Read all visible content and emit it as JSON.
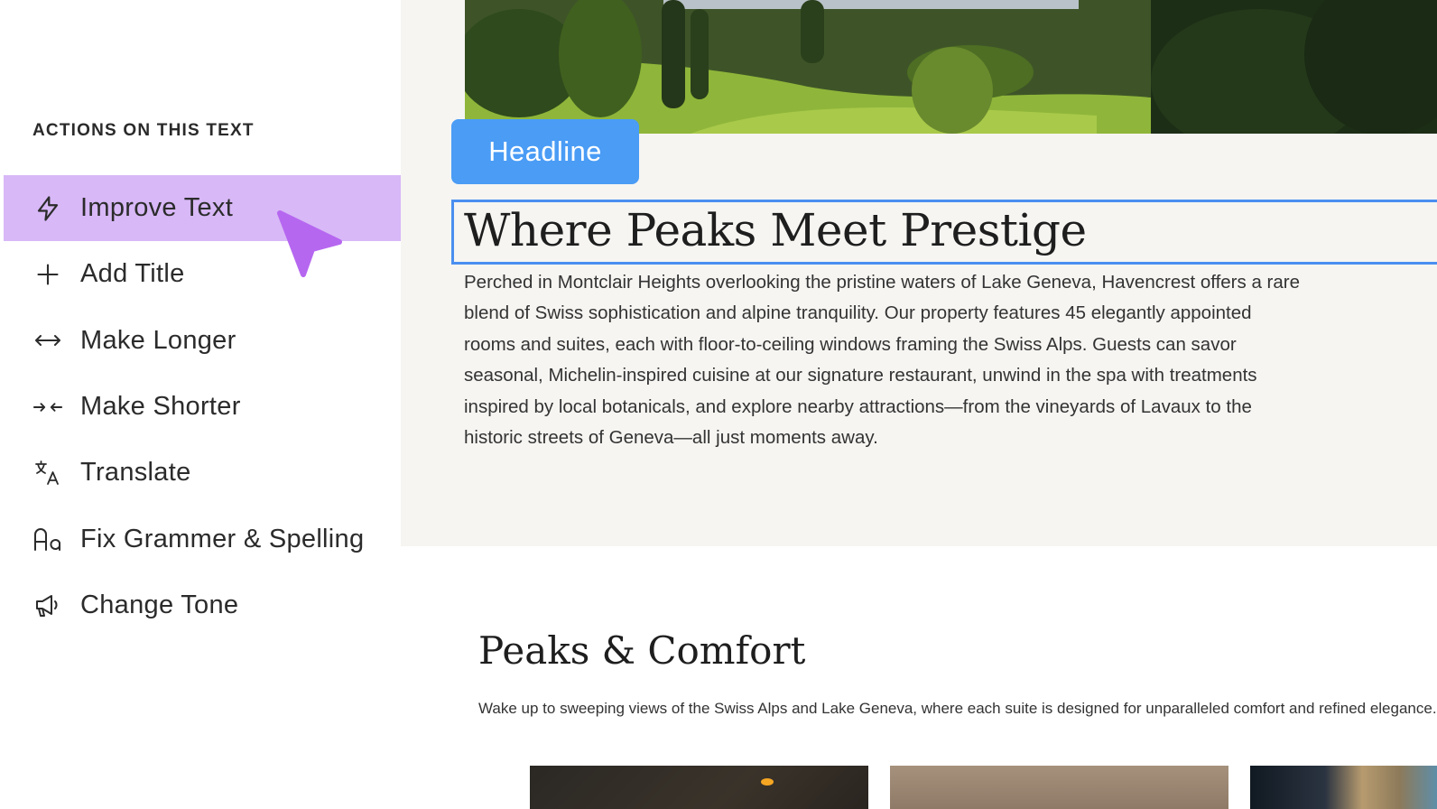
{
  "panel": {
    "title": "ACTIONS ON THIS TEXT",
    "items": [
      {
        "label": "Improve Text",
        "icon": "lightning-icon",
        "active": true
      },
      {
        "label": "Add Title",
        "icon": "plus-icon"
      },
      {
        "label": "Make Longer",
        "icon": "expand-arrows-icon"
      },
      {
        "label": "Make Shorter",
        "icon": "shrink-arrows-icon"
      },
      {
        "label": "Translate",
        "icon": "translate-icon"
      },
      {
        "label": "Fix Grammer & Spelling",
        "icon": "font-case-icon"
      },
      {
        "label": "Change Tone",
        "icon": "megaphone-icon"
      }
    ],
    "active_color": "#d8b8f7"
  },
  "editor": {
    "tag_label": "Headline",
    "tag_color": "#4a9cf5",
    "headline": "Where Peaks Meet Prestige",
    "body": "Perched in Montclair Heights overlooking the pristine waters of Lake Geneva, Havencrest offers a rare blend of Swiss sophistication and alpine tranquility. Our property features 45 elegantly appointed rooms and suites, each with floor-to-ceiling windows framing the Swiss Alps. Guests can savor seasonal, Michelin-inspired cuisine at our signature restaurant, unwind in the spa with treatments inspired by local botanicals, and explore nearby attractions—from the vineyards of Lavaux to the historic streets of Geneva—all just moments away."
  },
  "section": {
    "title": "Peaks & Comfort",
    "subtitle": "Wake up to sweeping views of the Swiss Alps and Lake Geneva, where each suite is designed for unparalleled comfort and refined elegance."
  }
}
